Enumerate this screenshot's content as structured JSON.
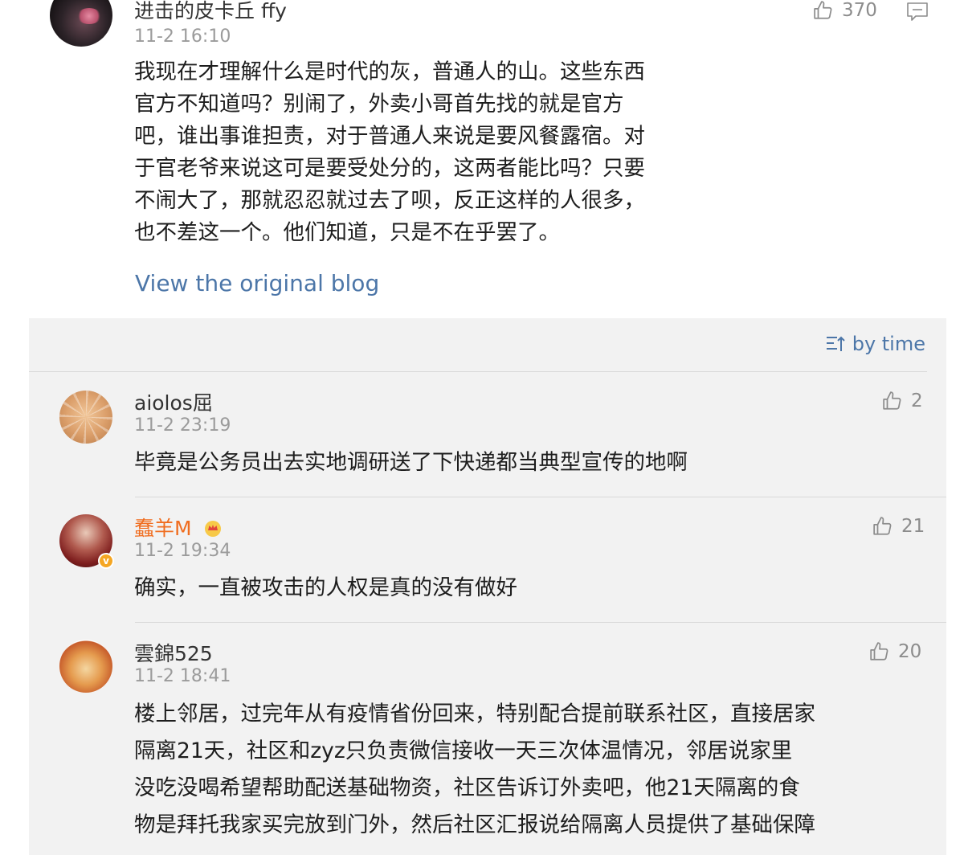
{
  "main_comment": {
    "username": "进击的皮卡丘 ffy",
    "time": "11-2 16:10",
    "likes": "370",
    "lines": [
      "我现在才理解什么是时代的灰，普通人的山。这些东西",
      "官方不知道吗？别闹了，外卖小哥首先找的就是官方",
      "吧，谁出事谁担责，对于普通人来说是要风餐露宿。对",
      "于官老爷来说这可是要受处分的，这两者能比吗？只要",
      "不闹大了，那就忍忍就过去了呗，反正这样的人很多，",
      "也不差这一个。他们知道，只是不在乎罢了。"
    ],
    "view_link": "View the original blog"
  },
  "replies": {
    "sort_label": "by time",
    "items": [
      {
        "username": "aiolos屈",
        "time": "11-2 23:19",
        "likes": "2",
        "lines": [
          "毕竟是公务员出去实地调研送了下快递都当典型宣传的地啊"
        ]
      },
      {
        "username": "蠢羊M",
        "time": "11-2 19:34",
        "likes": "21",
        "verified_badge": "v",
        "username_color": "#f06d1f",
        "lines": [
          "确实，一直被攻击的人权是真的没有做好"
        ]
      },
      {
        "username": "雲錦525",
        "time": "11-2 18:41",
        "likes": "20",
        "lines": [
          "楼上邻居，过完年从有疫情省份回来，特别配合提前联系社区，直接居家",
          "隔离21天，社区和zyz只负责微信接收一天三次体温情况，邻居说家里",
          "没吃没喝希望帮助配送基础物资，社区告诉订外卖吧，他21天隔离的食",
          "物是拜托我家买完放到门外，然后社区汇报说给隔离人员提供了基础保障"
        ]
      }
    ]
  },
  "colors": {
    "link": "#4c76a8",
    "reply_bg": "#f2f2f2",
    "vip_name": "#f06d1f"
  },
  "icons": [
    "thumbs-up-icon",
    "reply-comment-icon",
    "sort-icon",
    "crown-icon",
    "verified-icon"
  ]
}
